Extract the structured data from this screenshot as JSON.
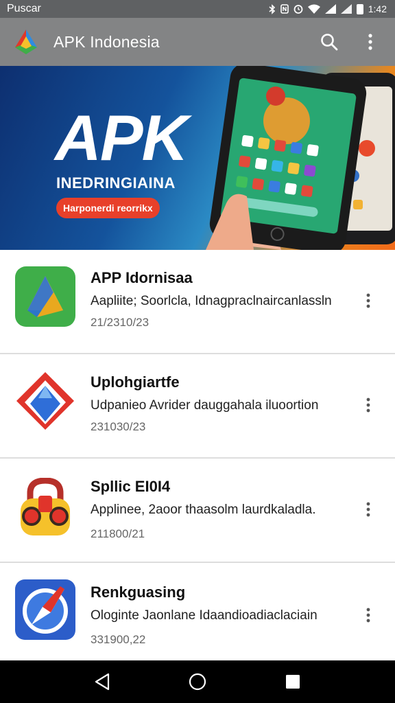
{
  "status_bar": {
    "carrier": "Puscar",
    "time": "1:42"
  },
  "app_bar": {
    "title": "APK Indonesia",
    "icons": [
      "app-logo",
      "search-icon",
      "more-vert-icon"
    ]
  },
  "banner": {
    "headline": "APK",
    "subtitle": "INEDRINGIAINA",
    "tag": "Harponerdi reorrikx"
  },
  "apps": [
    {
      "name": "APP Idornisaa",
      "description": "Aapliite; Soorlcla, Idnagpraclnaircanlassln",
      "date": "21/2310/23",
      "icon": "drive-triangle-icon"
    },
    {
      "name": "Uplohgiartfe",
      "description": "Udpanieo Avrider dauggahala iluoortion",
      "date": "231030/23",
      "icon": "red-blue-diamond-icon"
    },
    {
      "name": "Spllic EI0I4",
      "description": "Applinee, 2aoor thaasolm laurdkaladla.",
      "date": "211800/21",
      "icon": "yellow-lock-icon"
    },
    {
      "name": "Renkguasing",
      "description": "Ologinte Jaonlane Idaandioadiaclaciain",
      "date": "331900,22",
      "icon": "compass-icon"
    }
  ],
  "nav_bar": {
    "icons": [
      "back-icon",
      "home-icon",
      "recents-icon"
    ]
  }
}
